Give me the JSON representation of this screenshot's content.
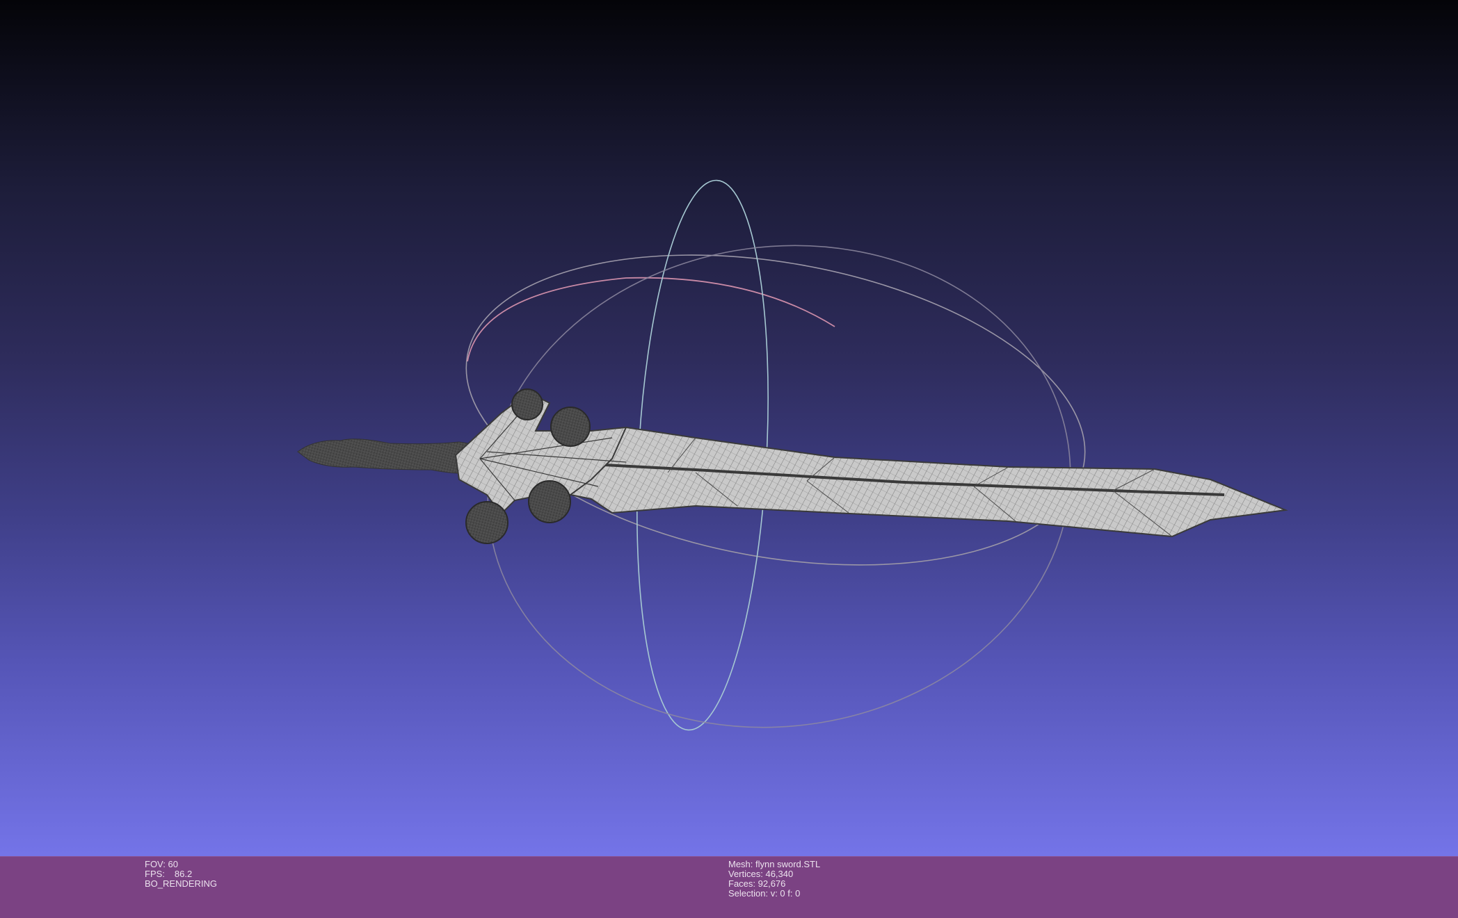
{
  "viewer": {
    "fov": "FOV: 60",
    "fps_label": "FPS:",
    "fps_value": "86.2",
    "render_mode": "BO_RENDERING"
  },
  "mesh": {
    "name": "Mesh: flynn sword.STL",
    "vertices": "Vertices: 46,340",
    "faces": "Faces: 92,676",
    "selection": "Selection: v: 0 f: 0"
  },
  "colors": {
    "background_top": "#040408",
    "background_bottom": "#7474e8",
    "info_bar": "#7b4283",
    "mesh_fill": "#c8c8c8",
    "wire": "#3a3a3a",
    "trackball_x": "#c98aa6",
    "trackball_y": "#a6c8d2",
    "trackball_z": "#9a96a6"
  },
  "icons": {
    "trackball": "trackball-icon",
    "mesh": "sword-mesh"
  }
}
